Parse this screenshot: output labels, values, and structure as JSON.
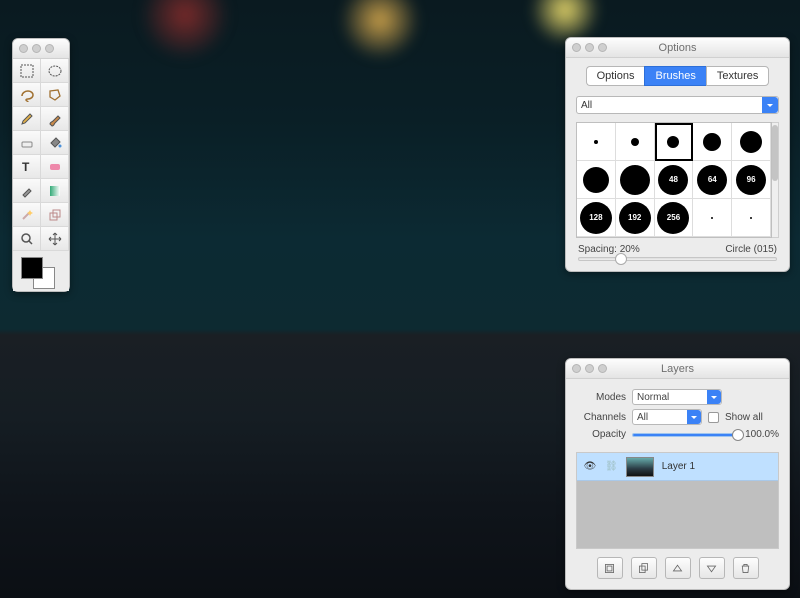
{
  "toolbox": {
    "tools": [
      "rect-select",
      "ellipse-select",
      "lasso",
      "poly-lasso",
      "pencil",
      "brush",
      "eraser",
      "bucket",
      "text",
      "smudge",
      "eyedropper",
      "gradient",
      "wand",
      "clone",
      "zoom",
      "move"
    ]
  },
  "options": {
    "title": "Options",
    "tabs": [
      "Options",
      "Brushes",
      "Textures"
    ],
    "active_tab": 1,
    "category": "All",
    "selected_index": 2,
    "brushes": [
      {
        "size": 4
      },
      {
        "size": 8
      },
      {
        "size": 12
      },
      {
        "size": 18
      },
      {
        "size": 22
      },
      {
        "size": 26
      },
      {
        "size": 30
      },
      {
        "size": 30,
        "label": "48"
      },
      {
        "size": 30,
        "label": "64"
      },
      {
        "size": 30,
        "label": "96"
      },
      {
        "size": 32,
        "label": "128"
      },
      {
        "size": 32,
        "label": "192"
      },
      {
        "size": 32,
        "label": "256"
      },
      {
        "size": 2
      },
      {
        "size": 2
      }
    ],
    "spacing_label": "Spacing: 20%",
    "brush_name": "Circle (015)",
    "spacing_pct": 20
  },
  "layers": {
    "title": "Layers",
    "modes_label": "Modes",
    "modes_value": "Normal",
    "channels_label": "Channels",
    "channels_value": "All",
    "showall_label": "Show all",
    "opacity_label": "Opacity",
    "opacity_value": "100.0%",
    "opacity_pct": 100,
    "items": [
      {
        "name": "Layer 1"
      }
    ],
    "buttons": [
      "new-layer",
      "duplicate-layer",
      "layer-up",
      "layer-down",
      "delete-layer"
    ]
  }
}
